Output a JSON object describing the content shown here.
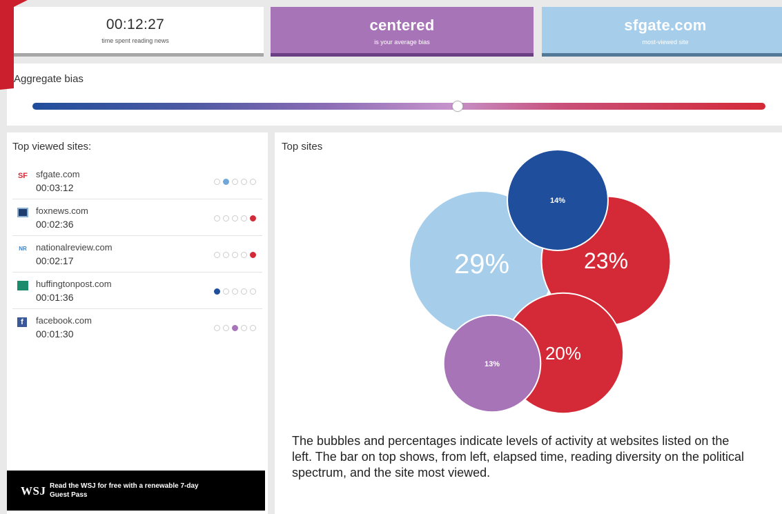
{
  "colors": {
    "red": "#d42a37",
    "dark_blue": "#1f4e9c",
    "light_blue": "#a6cdea",
    "purple": "#a874b8"
  },
  "stats": {
    "time": {
      "value": "00:12:27",
      "caption": "time spent reading news"
    },
    "bias": {
      "value": "centered",
      "caption": "is your average bias"
    },
    "site": {
      "value": "sfgate.com",
      "caption": "most-viewed site"
    }
  },
  "aggregate": {
    "heading": "Aggregate bias",
    "position_percent": 58
  },
  "top_viewed": {
    "heading": "Top viewed sites:",
    "sites": [
      {
        "icon": "sfgate-icon",
        "icon_text": "SF",
        "icon_color": "#d42a37",
        "name": "sfgate.com",
        "time": "00:03:12",
        "bias_dot": 1,
        "dot_color": "#6fa7d8"
      },
      {
        "icon": "foxnews-icon",
        "icon_text": "",
        "icon_color": "#1c3d6e",
        "name": "foxnews.com",
        "time": "00:02:36",
        "bias_dot": 4,
        "dot_color": "#d42a37"
      },
      {
        "icon": "nationalreview-icon",
        "icon_text": "NR",
        "icon_color": "#3a86c8",
        "name": "nationalreview.com",
        "time": "00:02:17",
        "bias_dot": 4,
        "dot_color": "#d42a37"
      },
      {
        "icon": "huffingtonpost-icon",
        "icon_text": "",
        "icon_color": "#1c8a6c",
        "name": "huffingtonpost.com",
        "time": "00:01:36",
        "bias_dot": 0,
        "dot_color": "#1f4e9c"
      },
      {
        "icon": "facebook-icon",
        "icon_text": "f",
        "icon_color": "#3b5998",
        "name": "facebook.com",
        "time": "00:01:30",
        "bias_dot": 2,
        "dot_color": "#a874b8"
      }
    ]
  },
  "ad": {
    "logo": "WSJ",
    "text": "Read the WSJ for free with a renewable 7-day Guest Pass"
  },
  "top_sites": {
    "heading": "Top sites",
    "bubbles": [
      {
        "label": "29%",
        "value": 29,
        "color": "#a6cdea"
      },
      {
        "label": "23%",
        "value": 23,
        "color": "#d42a37"
      },
      {
        "label": "20%",
        "value": 20,
        "color": "#d42a37"
      },
      {
        "label": "14%",
        "value": 14,
        "color": "#1f4e9c"
      },
      {
        "label": "13%",
        "value": 13,
        "color": "#a874b8"
      }
    ]
  },
  "caption": "The bubbles and percentages indicate levels of activity at websites listed on the left. The bar on top shows, from left, elapsed time, reading diversity on the political spectrum, and the site most viewed."
}
